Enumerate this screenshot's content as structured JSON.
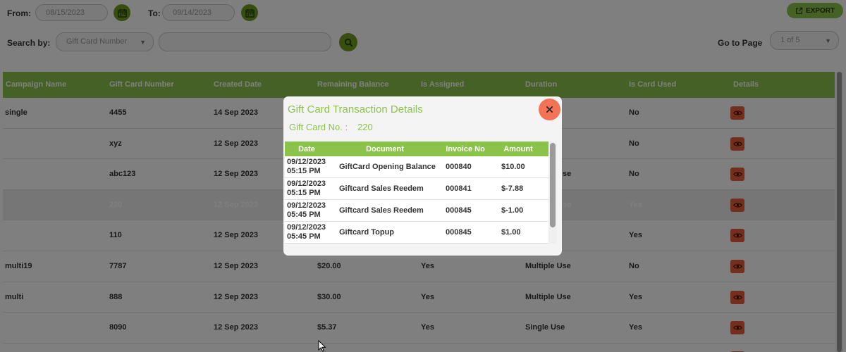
{
  "filters": {
    "from_label": "From:",
    "from_value": "08/15/2023",
    "to_label": "To:",
    "to_value": "09/14/2023",
    "export_label": "EXPORT",
    "search_by_label": "Search by:",
    "search_by_selected": "Gift Card Number",
    "search_value": "",
    "go_to_page_label": "Go to Page",
    "page_selected": "1 of 5"
  },
  "table": {
    "headers": [
      "Campaign Name",
      "Gift Card Number",
      "Created Date",
      "Remaining Balance",
      "Is Assigned",
      "Duration",
      "Is Card Used",
      "Details"
    ],
    "rows": [
      {
        "campaign": "single",
        "number": "4455",
        "created": "14 Sep 2023",
        "balance": "",
        "assigned": "",
        "duration": "",
        "used": "No"
      },
      {
        "campaign": "",
        "number": "xyz",
        "created": "12 Sep 2023",
        "balance": "",
        "assigned": "",
        "duration": "",
        "used": "No"
      },
      {
        "campaign": "",
        "number": "abc123",
        "created": "12 Sep 2023",
        "balance": "",
        "assigned": "",
        "duration": "se",
        "used": "No"
      },
      {
        "campaign": "",
        "number": "220",
        "created": "12 Sep 2023",
        "balance": "",
        "assigned": "",
        "duration": "se",
        "used": "Yes"
      },
      {
        "campaign": "",
        "number": "110",
        "created": "12 Sep 2023",
        "balance": "",
        "assigned": "",
        "duration": "",
        "used": "Yes"
      },
      {
        "campaign": "multi19",
        "number": "7787",
        "created": "12 Sep 2023",
        "balance": "$20.00",
        "assigned": "Yes",
        "duration": "Multiple Use",
        "used": "No"
      },
      {
        "campaign": "multi",
        "number": "888",
        "created": "12 Sep 2023",
        "balance": "$30.00",
        "assigned": "Yes",
        "duration": "Multiple Use",
        "used": "Yes"
      },
      {
        "campaign": "",
        "number": "8090",
        "created": "12 Sep 2023",
        "balance": "$5.37",
        "assigned": "Yes",
        "duration": "Single Use",
        "used": "Yes"
      }
    ]
  },
  "modal": {
    "title": "Gift Card Transaction Details",
    "card_no_label": "Gift Card No.   :",
    "card_no_value": "220",
    "columns": [
      "Date",
      "Document",
      "Invoice No",
      "Amount"
    ],
    "transactions": [
      {
        "date": "09/12/2023",
        "time": "05:15 PM",
        "document": "GiftCard Opening Balance",
        "invoice": "000840",
        "amount": "$10.00"
      },
      {
        "date": "09/12/2023",
        "time": "05:15 PM",
        "document": "Giftcard Sales Reedem",
        "invoice": "000841",
        "amount": "$-7.88"
      },
      {
        "date": "09/12/2023",
        "time": "05:45 PM",
        "document": "Giftcard Sales Reedem",
        "invoice": "000845",
        "amount": "$-1.00"
      },
      {
        "date": "09/12/2023",
        "time": "05:45 PM",
        "document": "Giftcard Topup",
        "invoice": "000845",
        "amount": "$1.00"
      }
    ]
  },
  "colors": {
    "accent_green": "#8bc34a",
    "button_green": "#6f9c1e",
    "details_button": "#e85d3a",
    "close_button": "#f47356"
  },
  "icons": {
    "calendar": "calendar-icon",
    "export": "export-icon",
    "search": "search-icon",
    "details": "eye-icon",
    "close": "close-icon"
  }
}
